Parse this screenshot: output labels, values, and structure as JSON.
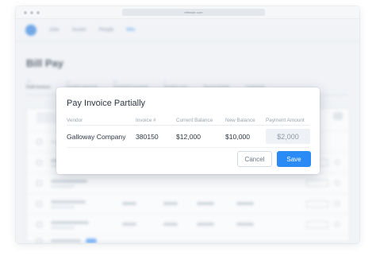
{
  "browser": {
    "url": "eftimate.com"
  },
  "app": {
    "nav": [
      "Jobs",
      "Assets",
      "People",
      "Bills"
    ],
    "page_title": "Bill Pay",
    "tabs": [
      "Draft Invoices",
      "Pending approval",
      "Scheduled payment",
      "Pending sync",
      "Recent Activity",
      "Completed"
    ]
  },
  "modal": {
    "title": "Pay Invoice Partially",
    "columns": {
      "vendor": "Vendor",
      "invoice": "Invoice #",
      "current_balance": "Current Balance",
      "new_balance": "New Balance",
      "payment_amount": "Payment Amount"
    },
    "row": {
      "vendor": "Galloway Company",
      "invoice": "380150",
      "current_balance": "$12,000",
      "new_balance": "$10,000",
      "payment_amount": "$2,000"
    },
    "cancel_label": "Cancel",
    "save_label": "Save"
  },
  "colors": {
    "accent": "#2a8af6",
    "title_text": "#2d3642",
    "muted_text": "#9aa3ae"
  }
}
